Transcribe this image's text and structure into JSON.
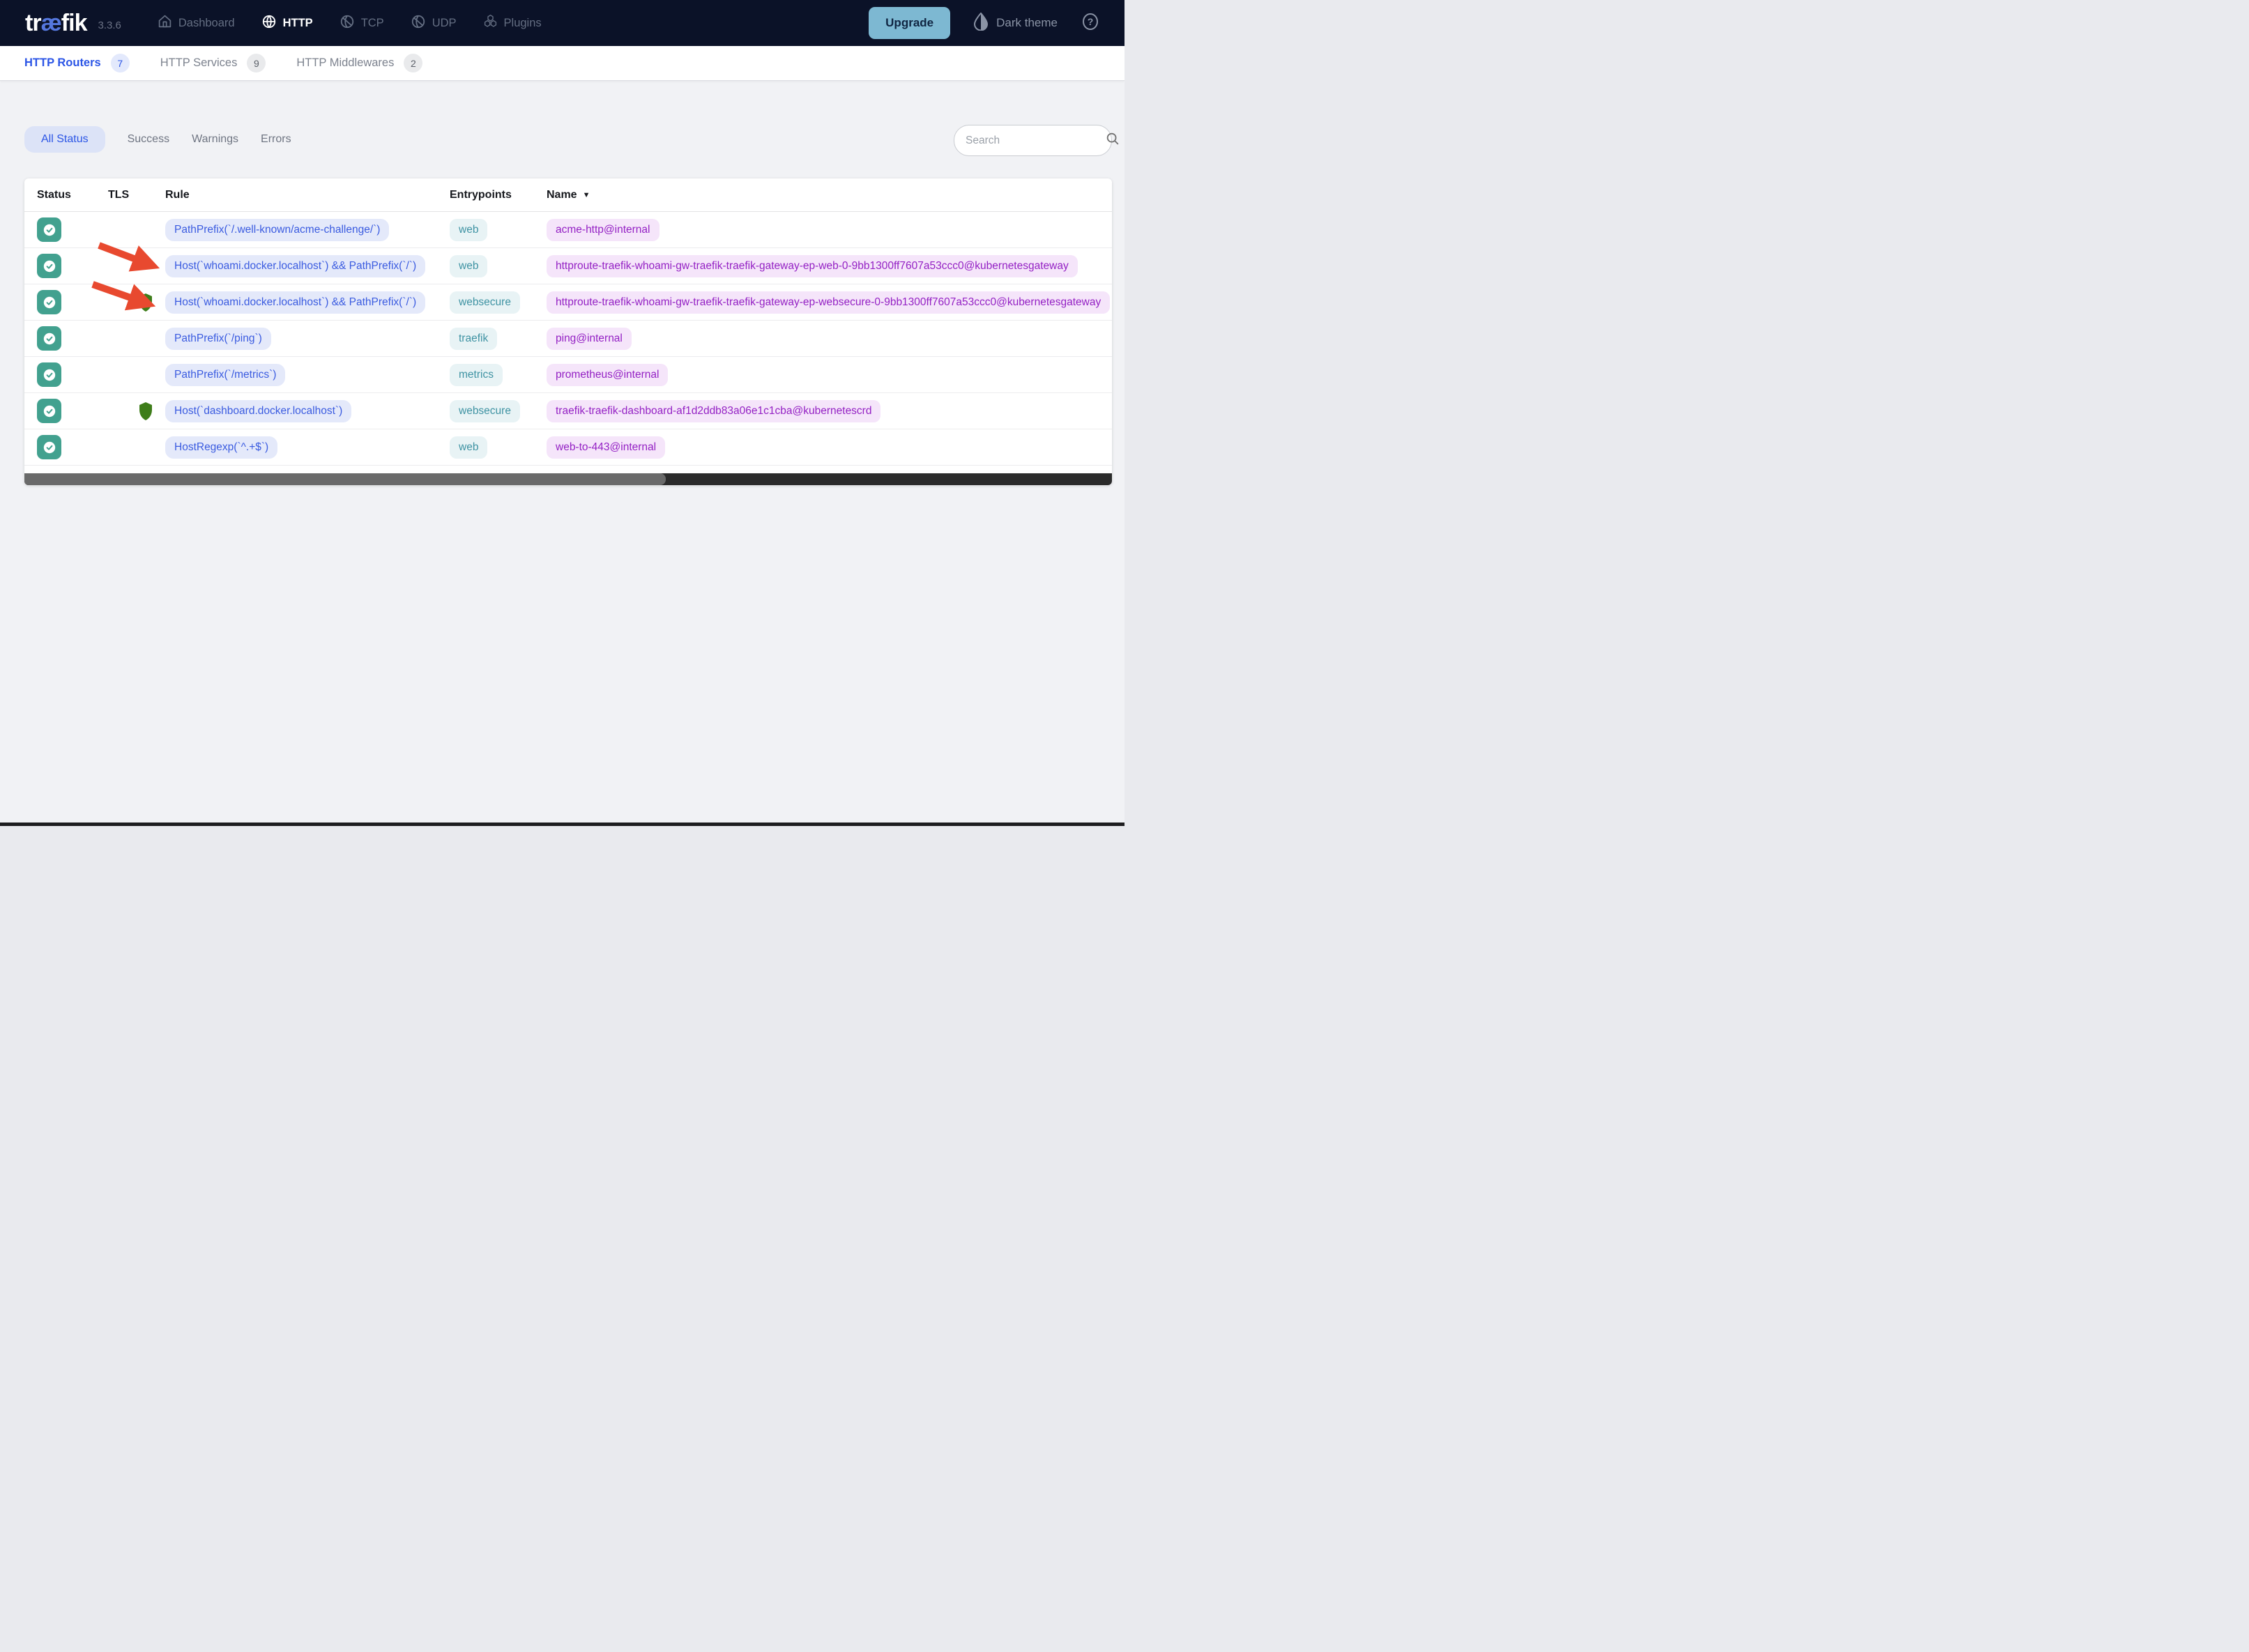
{
  "navbar": {
    "logo": {
      "prefix": "tr",
      "ligature": "æ",
      "suffix": "fik"
    },
    "version": "3.3.6",
    "items": [
      {
        "label": "Dashboard",
        "icon": "home-icon",
        "active": false
      },
      {
        "label": "HTTP",
        "icon": "globe-icon",
        "active": true
      },
      {
        "label": "TCP",
        "icon": "globe-icon",
        "active": false
      },
      {
        "label": "UDP",
        "icon": "globe-icon",
        "active": false
      },
      {
        "label": "Plugins",
        "icon": "cubes-icon",
        "active": false
      }
    ],
    "upgrade_label": "Upgrade",
    "theme_label": "Dark theme"
  },
  "tabs": [
    {
      "label": "HTTP Routers",
      "count": "7",
      "active": true
    },
    {
      "label": "HTTP Services",
      "count": "9",
      "active": false
    },
    {
      "label": "HTTP Middlewares",
      "count": "2",
      "active": false
    }
  ],
  "filters": [
    {
      "label": "All Status",
      "active": true
    },
    {
      "label": "Success",
      "active": false
    },
    {
      "label": "Warnings",
      "active": false
    },
    {
      "label": "Errors",
      "active": false
    }
  ],
  "search": {
    "placeholder": "Search"
  },
  "table": {
    "columns": [
      "Status",
      "TLS",
      "Rule",
      "Entrypoints",
      "Name"
    ],
    "sorted_column": "Name",
    "sort_direction": "asc",
    "rows": [
      {
        "status": "success",
        "tls": false,
        "rule": "PathPrefix(`/.well-known/acme-challenge/`)",
        "entrypoint": "web",
        "name": "acme-http@internal"
      },
      {
        "status": "success",
        "tls": false,
        "rule": "Host(`whoami.docker.localhost`) && PathPrefix(`/`)",
        "entrypoint": "web",
        "name": "httproute-traefik-whoami-gw-traefik-traefik-gateway-ep-web-0-9bb1300ff7607a53ccc0@kubernetesgateway"
      },
      {
        "status": "success",
        "tls": true,
        "rule": "Host(`whoami.docker.localhost`) && PathPrefix(`/`)",
        "entrypoint": "websecure",
        "name": "httproute-traefik-whoami-gw-traefik-traefik-gateway-ep-websecure-0-9bb1300ff7607a53ccc0@kubernetesgateway"
      },
      {
        "status": "success",
        "tls": false,
        "rule": "PathPrefix(`/ping`)",
        "entrypoint": "traefik",
        "name": "ping@internal"
      },
      {
        "status": "success",
        "tls": false,
        "rule": "PathPrefix(`/metrics`)",
        "entrypoint": "metrics",
        "name": "prometheus@internal"
      },
      {
        "status": "success",
        "tls": true,
        "rule": "Host(`dashboard.docker.localhost`)",
        "entrypoint": "websecure",
        "name": "traefik-traefik-dashboard-af1d2ddb83a06e1c1cba@kubernetescrd"
      },
      {
        "status": "success",
        "tls": false,
        "rule": "HostRegexp(`^.+$`)",
        "entrypoint": "web",
        "name": "web-to-443@internal"
      }
    ]
  },
  "scrollbar": {
    "thumb_fraction": 0.59
  },
  "colors": {
    "accent": "#2b55e6",
    "navbarBg": "#0b1228",
    "upgradeBg": "#7db8d2",
    "upgradeText": "#102542",
    "successTeal": "#42a18f",
    "tlsGreen": "#3e7d1a",
    "arrowRed": "#e8492f",
    "ruleChipBg": "#e4e9fa",
    "ruleChipText": "#3a5be0",
    "entryChipBg": "#e8f3f5",
    "entryChipText": "#3f93a3",
    "nameChipBg": "#f5e5fa",
    "nameChipText": "#9421c4",
    "pageBg": "#f1f2f5",
    "scrollTrack": "#2b2b2b",
    "scrollThumb": "#6a6a6a"
  }
}
